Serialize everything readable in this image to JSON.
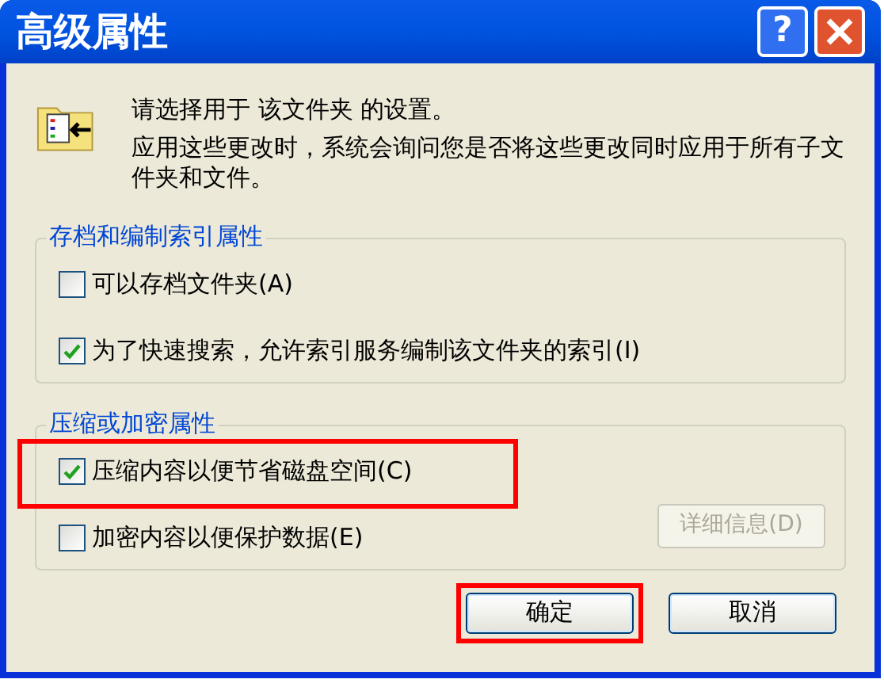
{
  "window": {
    "title": "高级属性",
    "help_button": "?"
  },
  "intro": {
    "line_1": "请选择用于 该文件夹 的设置。",
    "line_2": "应用这些更改时，系统会询问您是否将这些更改同时应用于所有子文件夹和文件。"
  },
  "groups": [
    {
      "title": "存档和编制索引属性",
      "options": [
        {
          "label": "可以存档文件夹(A)",
          "checked": false,
          "highlighted": false
        },
        {
          "label": "为了快速搜索，允许索引服务编制该文件夹的索引(I)",
          "checked": true,
          "highlighted": false
        }
      ]
    },
    {
      "title": "压缩或加密属性",
      "options": [
        {
          "label": "压缩内容以便节省磁盘空间(C)",
          "checked": true,
          "highlighted": true
        },
        {
          "label": "加密内容以便保护数据(E)",
          "checked": false,
          "highlighted": false
        }
      ],
      "details_button": {
        "label": "详细信息(D)",
        "disabled": true
      }
    }
  ],
  "buttons": [
    {
      "label": "确定",
      "highlighted": true
    },
    {
      "label": "取消",
      "highlighted": false
    }
  ]
}
